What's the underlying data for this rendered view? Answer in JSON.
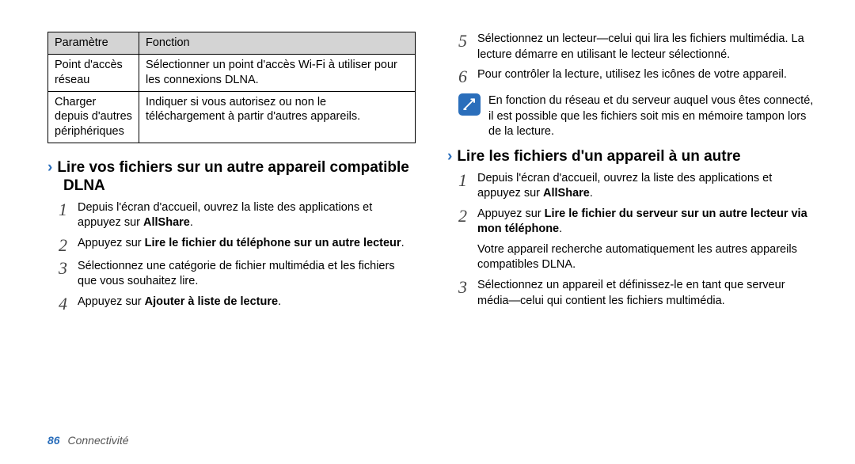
{
  "table": {
    "head": {
      "c1": "Paramètre",
      "c2": "Fonction"
    },
    "rows": [
      {
        "c1": "Point d'accès réseau",
        "c2": "Sélectionner un point d'accès Wi-Fi à utiliser pour les connexions DLNA."
      },
      {
        "c1": "Charger depuis d'autres périphériques",
        "c2": "Indiquer si vous autorisez ou non le téléchargement à partir d'autres appareils."
      }
    ]
  },
  "left": {
    "heading": "Lire vos fichiers sur un autre appareil compatible DLNA",
    "steps": {
      "s1a": "Depuis l'écran d'accueil, ouvrez la liste des applications et appuyez sur ",
      "s1b": "AllShare",
      "s1c": ".",
      "s2a": "Appuyez sur ",
      "s2b": "Lire le fichier du téléphone sur un autre lecteur",
      "s2c": ".",
      "s3": "Sélectionnez une catégorie de fichier multimédia et les fichiers que vous souhaitez lire.",
      "s4a": "Appuyez sur ",
      "s4b": "Ajouter à liste de lecture",
      "s4c": "."
    }
  },
  "right": {
    "steps_top": {
      "s5": "Sélectionnez un lecteur—celui qui lira les fichiers multimédia. La lecture démarre en utilisant le lecteur sélectionné.",
      "s6": "Pour contrôler la lecture, utilisez les icônes de votre appareil."
    },
    "note": "En fonction du réseau et du serveur auquel vous êtes connecté, il est possible que les fichiers soit mis en mémoire tampon lors de la lecture.",
    "heading": "Lire les fichiers d'un appareil à un autre",
    "steps": {
      "s1a": "Depuis l'écran d'accueil, ouvrez la liste des applications et appuyez sur ",
      "s1b": "AllShare",
      "s1c": ".",
      "s2a": "Appuyez sur ",
      "s2b": "Lire le fichier du serveur sur un autre lecteur via mon téléphone",
      "s2c": ".",
      "s2d": "Votre appareil recherche automatiquement les autres appareils compatibles DLNA.",
      "s3": "Sélectionnez un appareil et définissez-le en tant que serveur média—celui qui contient les fichiers multimédia."
    }
  },
  "footer": {
    "page": "86",
    "section": "Connectivité"
  }
}
